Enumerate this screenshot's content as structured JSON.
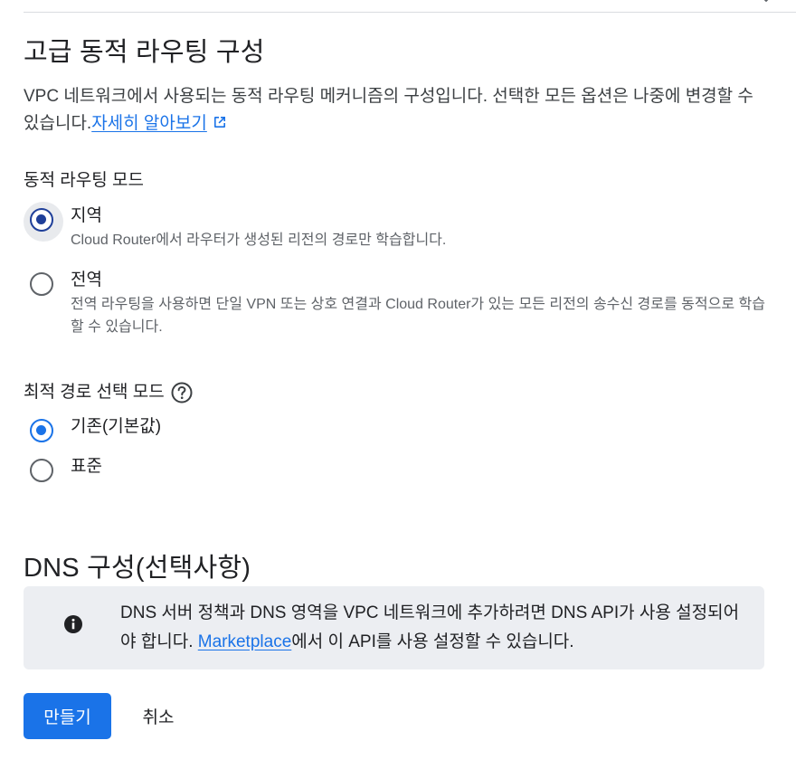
{
  "advanced_routing": {
    "title": "고급 동적 라우팅 구성",
    "description": "VPC 네트워크에서 사용되는 동적 라우팅 메커니즘의 구성입니다. 선택한 모든 옵션은 나중에 변경할 수 있습니다.",
    "learn_more_link": "자세히 알아보기",
    "learn_more_icon": "open-in-new-icon"
  },
  "routing_mode": {
    "label": "동적 라우팅 모드",
    "selected": "regional",
    "options": [
      {
        "id": "regional",
        "label": "지역",
        "description": "Cloud Router에서 라우터가 생성된 리전의 경로만 학습합니다."
      },
      {
        "id": "global",
        "label": "전역",
        "description": "전역 라우팅을 사용하면 단일 VPN 또는 상호 연결과 Cloud Router가 있는 모든 리전의 송수신 경로를 동적으로 학습할 수 있습니다."
      }
    ]
  },
  "best_path_mode": {
    "label": "최적 경로 선택 모드",
    "help_icon": "help-circle-icon",
    "selected": "legacy",
    "options": [
      {
        "id": "legacy",
        "label": "기존(기본값)"
      },
      {
        "id": "standard",
        "label": "표준"
      }
    ]
  },
  "dns": {
    "title": "DNS 구성(선택사항)",
    "notice_icon": "info-icon",
    "notice_text_before": "DNS 서버 정책과 DNS 영역을 VPC 네트워크에 추가하려면 DNS API가 사용 설정되어야 합니다. ",
    "notice_link": "Marketplace",
    "notice_text_after": "에서 이 API를 사용 설정할 수 있습니다."
  },
  "actions": {
    "create_label": "만들기",
    "cancel_label": "취소"
  },
  "colors": {
    "primary": "#1a73e8",
    "text": "#202124",
    "secondary_text": "#5f6368",
    "notice_bg": "#eceef2"
  }
}
